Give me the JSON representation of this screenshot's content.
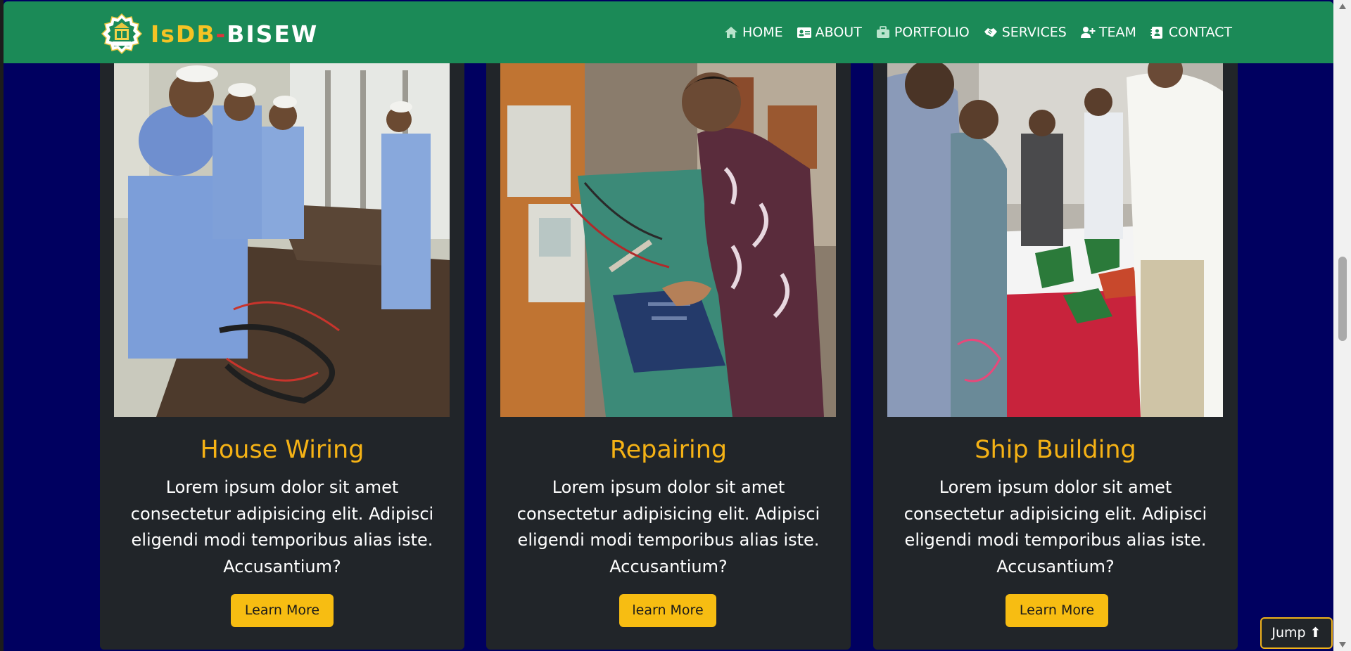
{
  "brand": {
    "part1": "IsDB",
    "dash": "-",
    "part2": "BISEW",
    "logo_icon": "isdb-bisew-logo"
  },
  "nav": [
    {
      "label": "HOME",
      "icon": "home-icon"
    },
    {
      "label": "ABOUT",
      "icon": "id-card-icon"
    },
    {
      "label": "PORTFOLIO",
      "icon": "briefcase-icon"
    },
    {
      "label": "SERVICES",
      "icon": "handshake-icon"
    },
    {
      "label": "TEAM",
      "icon": "user-plus-icon"
    },
    {
      "label": "CONTACT",
      "icon": "contact-card-icon"
    }
  ],
  "cards": [
    {
      "title": "House Wiring",
      "text": "Lorem ipsum dolor sit amet consectetur adipisicing elit. Adipisci eligendi modi temporibus alias iste. Accusantium?",
      "button": "Learn More",
      "image": "students-wiring-photo"
    },
    {
      "title": "Repairing",
      "text": "Lorem ipsum dolor sit amet consectetur adipisicing elit. Adipisci eligendi modi temporibus alias iste. Accusantium?",
      "button": "learn More",
      "image": "electronics-repair-photo"
    },
    {
      "title": "Ship Building",
      "text": "Lorem ipsum dolor sit amet consectetur adipisicing elit. Adipisci eligendi modi temporibus alias iste. Accusantium?",
      "button": "Learn More",
      "image": "ship-building-exhibit-photo"
    }
  ],
  "jump_button": "Jump ⬆",
  "colors": {
    "navbar": "#1b8a57",
    "page_bg": "#000060",
    "card_bg": "#212529",
    "accent": "#f5b215"
  }
}
